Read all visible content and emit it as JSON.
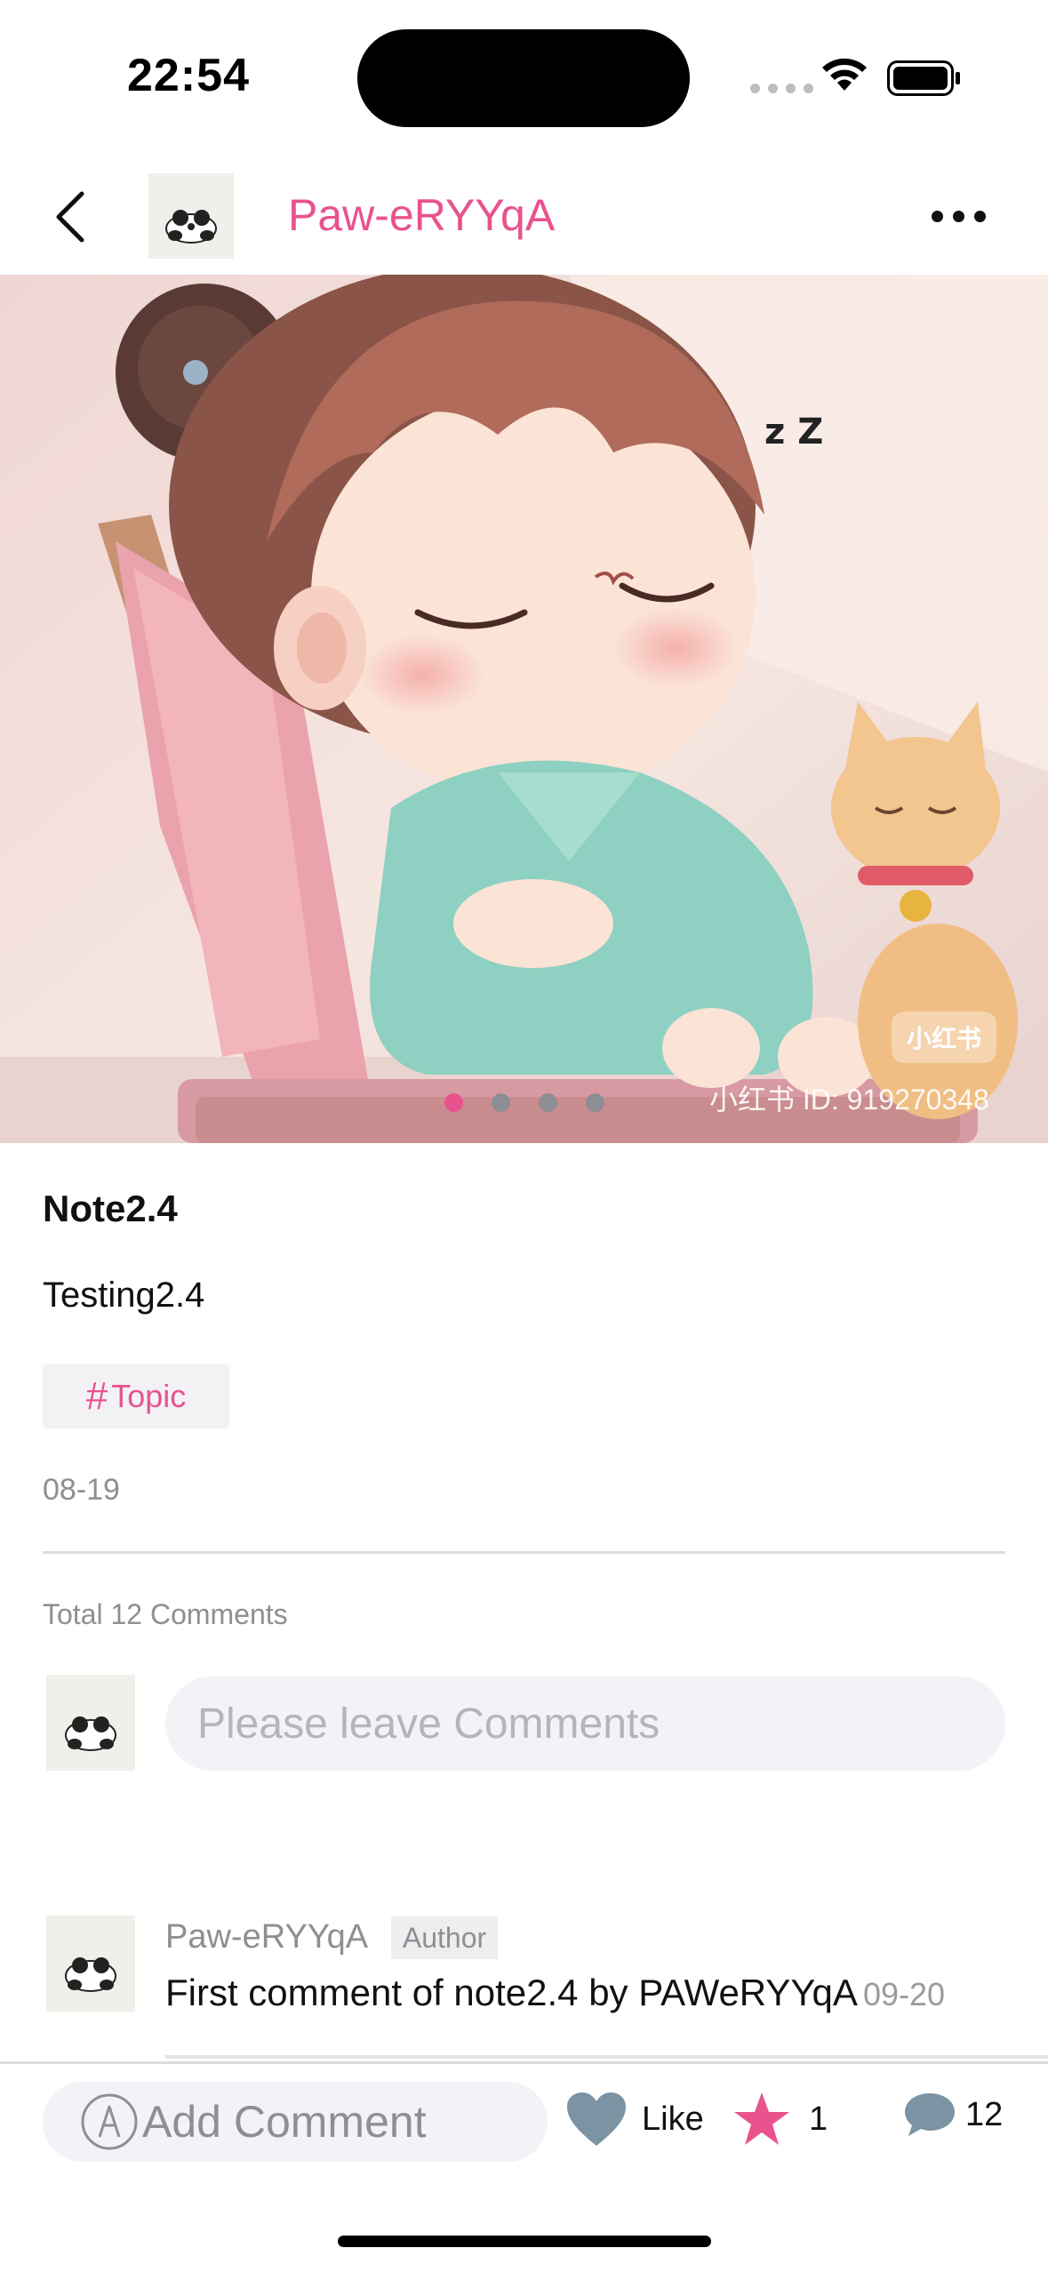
{
  "status_bar": {
    "time": "22:54"
  },
  "header": {
    "username": "Paw-eRYYqA"
  },
  "hero": {
    "watermark": "小红书 ID: 919270348",
    "badge": "小红书",
    "slide_count": 4,
    "active_slide": 1,
    "zz_text": "z Z"
  },
  "note": {
    "title": "Note2.4",
    "description": "Testing2.4",
    "topic_hash": "#",
    "topic": "Topic",
    "date": "08-19"
  },
  "comments": {
    "total_label": "Total 12 Comments",
    "input_placeholder": "Please leave Comments",
    "items": [
      {
        "author": "Paw-eRYYqA",
        "badge": "Author",
        "text": "First comment of note2.4 by PAWeRYYqA",
        "time": "09-20"
      }
    ]
  },
  "bottom_bar": {
    "add_comment": "Add Comment",
    "like_label": "Like",
    "favorites_count": "1",
    "comments_count": "12"
  },
  "colors": {
    "accent": "#e8538e",
    "muted": "#8e8e93",
    "heart_gray": "#7c93a3",
    "comment_bubble": "#7c93a3"
  }
}
